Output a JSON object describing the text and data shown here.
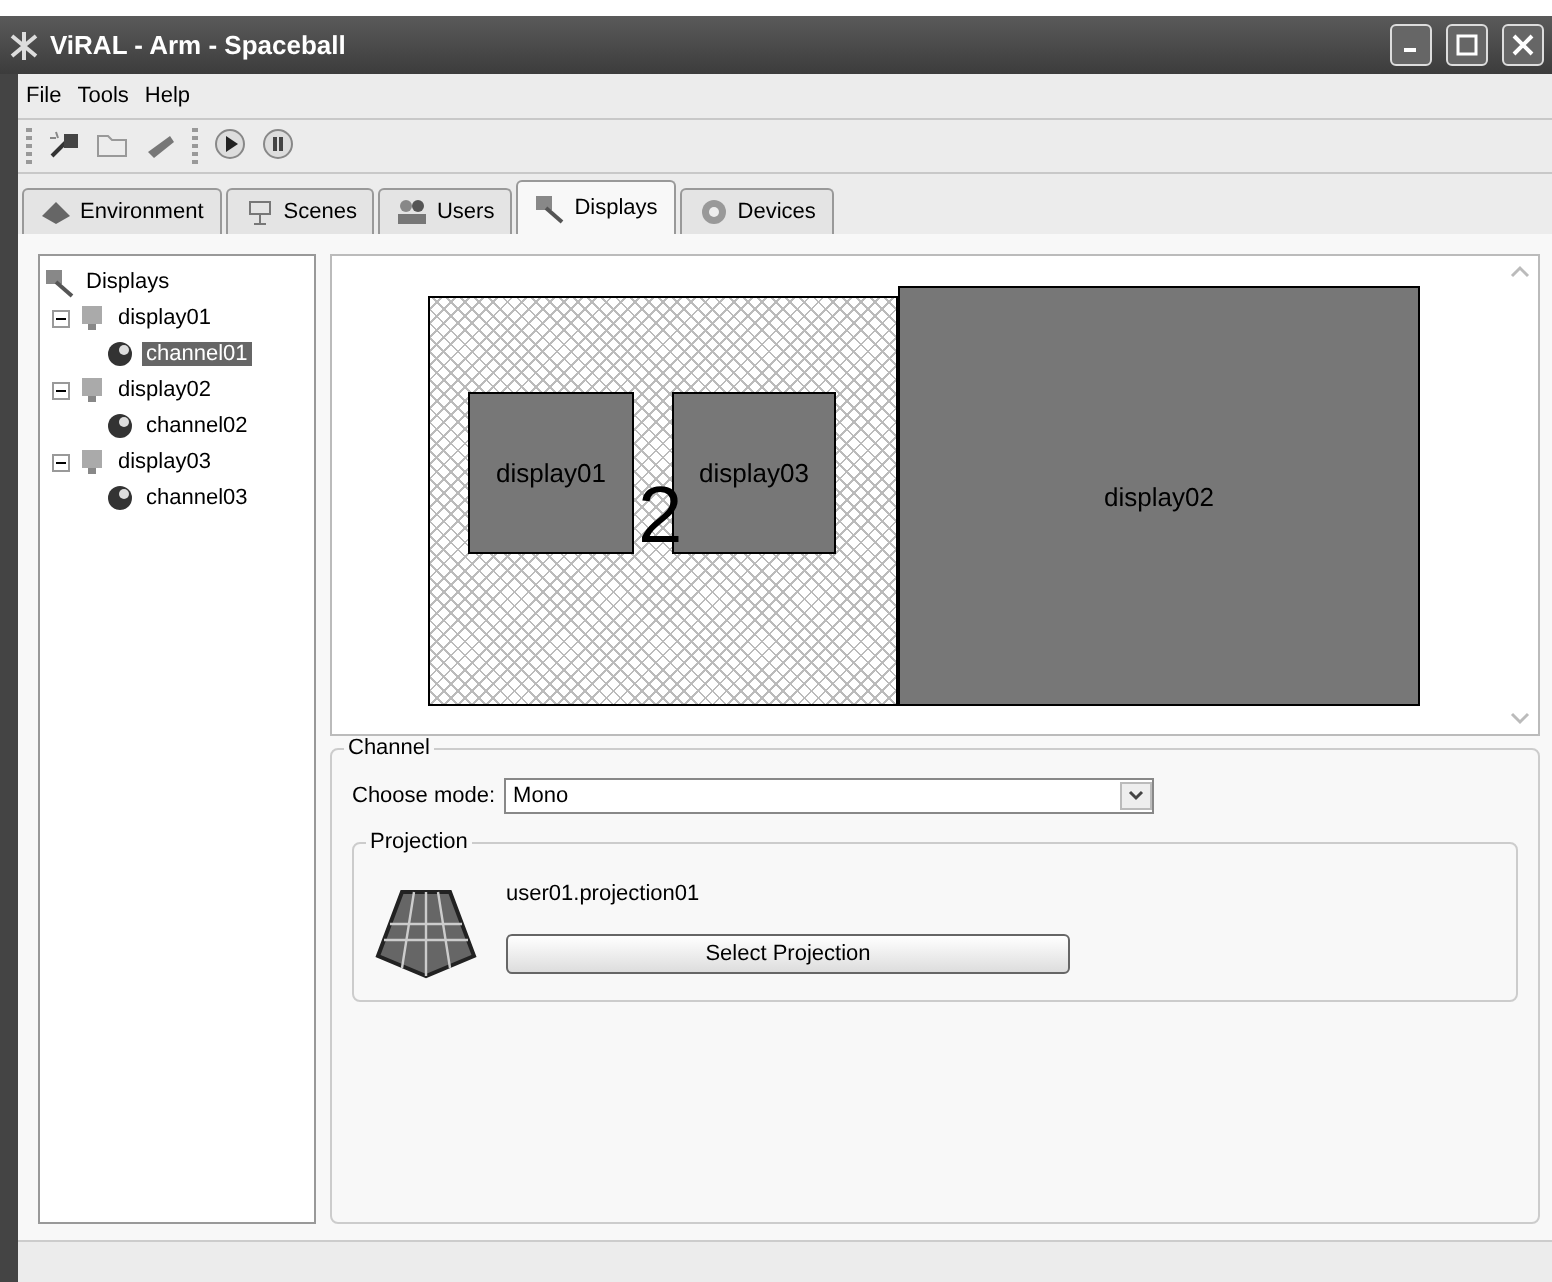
{
  "window": {
    "title": "ViRAL - Arm - Spaceball"
  },
  "menu": [
    "File",
    "Tools",
    "Help"
  ],
  "tabs": [
    {
      "label": "Environment",
      "selected": false
    },
    {
      "label": "Scenes",
      "selected": false
    },
    {
      "label": "Users",
      "selected": false
    },
    {
      "label": "Displays",
      "selected": true
    },
    {
      "label": "Devices",
      "selected": false
    }
  ],
  "tree": {
    "label": "Displays",
    "children": [
      {
        "label": "display01",
        "expanded": true,
        "children": [
          {
            "label": "channel01",
            "selected": true
          }
        ]
      },
      {
        "label": "display02",
        "expanded": true,
        "children": [
          {
            "label": "channel02",
            "selected": false
          }
        ]
      },
      {
        "label": "display03",
        "expanded": true,
        "children": [
          {
            "label": "channel03",
            "selected": false
          }
        ]
      }
    ]
  },
  "canvas": {
    "group_label": "2",
    "displays": [
      {
        "label": "display02",
        "kind": "large"
      },
      {
        "label": "display01",
        "kind": "small"
      },
      {
        "label": "display03",
        "kind": "small"
      }
    ]
  },
  "channel": {
    "title": "Channel",
    "mode_label": "Choose mode:",
    "mode_value": "Mono",
    "projection": {
      "title": "Projection",
      "name": "user01.projection01",
      "button": "Select Projection"
    }
  }
}
